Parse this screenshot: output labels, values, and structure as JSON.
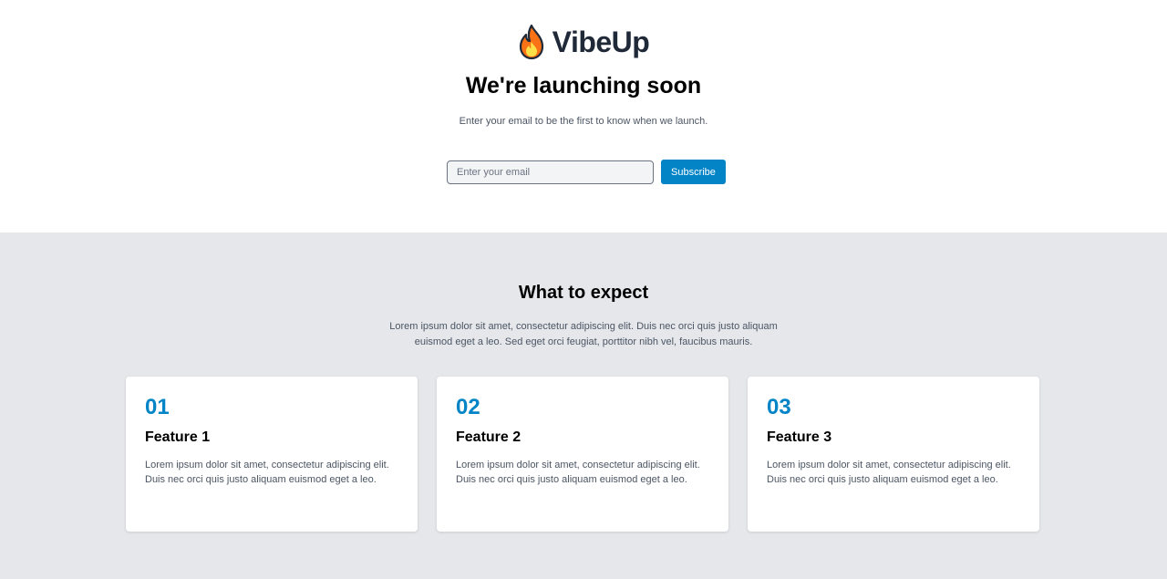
{
  "brand": {
    "name": "VibeUp",
    "icon": "flame-icon"
  },
  "hero": {
    "title": "We're launching soon",
    "subtitle": "Enter your email to be the first to know when we launch.",
    "email_placeholder": "Enter your email",
    "subscribe_label": "Subscribe"
  },
  "features": {
    "title": "What to expect",
    "description": "Lorem ipsum dolor sit amet, consectetur adipiscing elit. Duis nec orci quis justo aliquam euismod eget a leo. Sed eget orci feugiat, porttitor nibh vel, faucibus mauris.",
    "cards": [
      {
        "number": "01",
        "title": "Feature 1",
        "text": "Lorem ipsum dolor sit amet, consectetur adipiscing elit. Duis nec orci quis justo aliquam euismod eget a leo."
      },
      {
        "number": "02",
        "title": "Feature 2",
        "text": "Lorem ipsum dolor sit amet, consectetur adipiscing elit. Duis nec orci quis justo aliquam euismod eget a leo."
      },
      {
        "number": "03",
        "title": "Feature 3",
        "text": "Lorem ipsum dolor sit amet, consectetur adipiscing elit. Duis nec orci quis justo aliquam euismod eget a leo."
      }
    ]
  },
  "colors": {
    "accent": "#0284c7",
    "features_bg": "#e5e7eb",
    "brand_text": "#1f2937"
  }
}
